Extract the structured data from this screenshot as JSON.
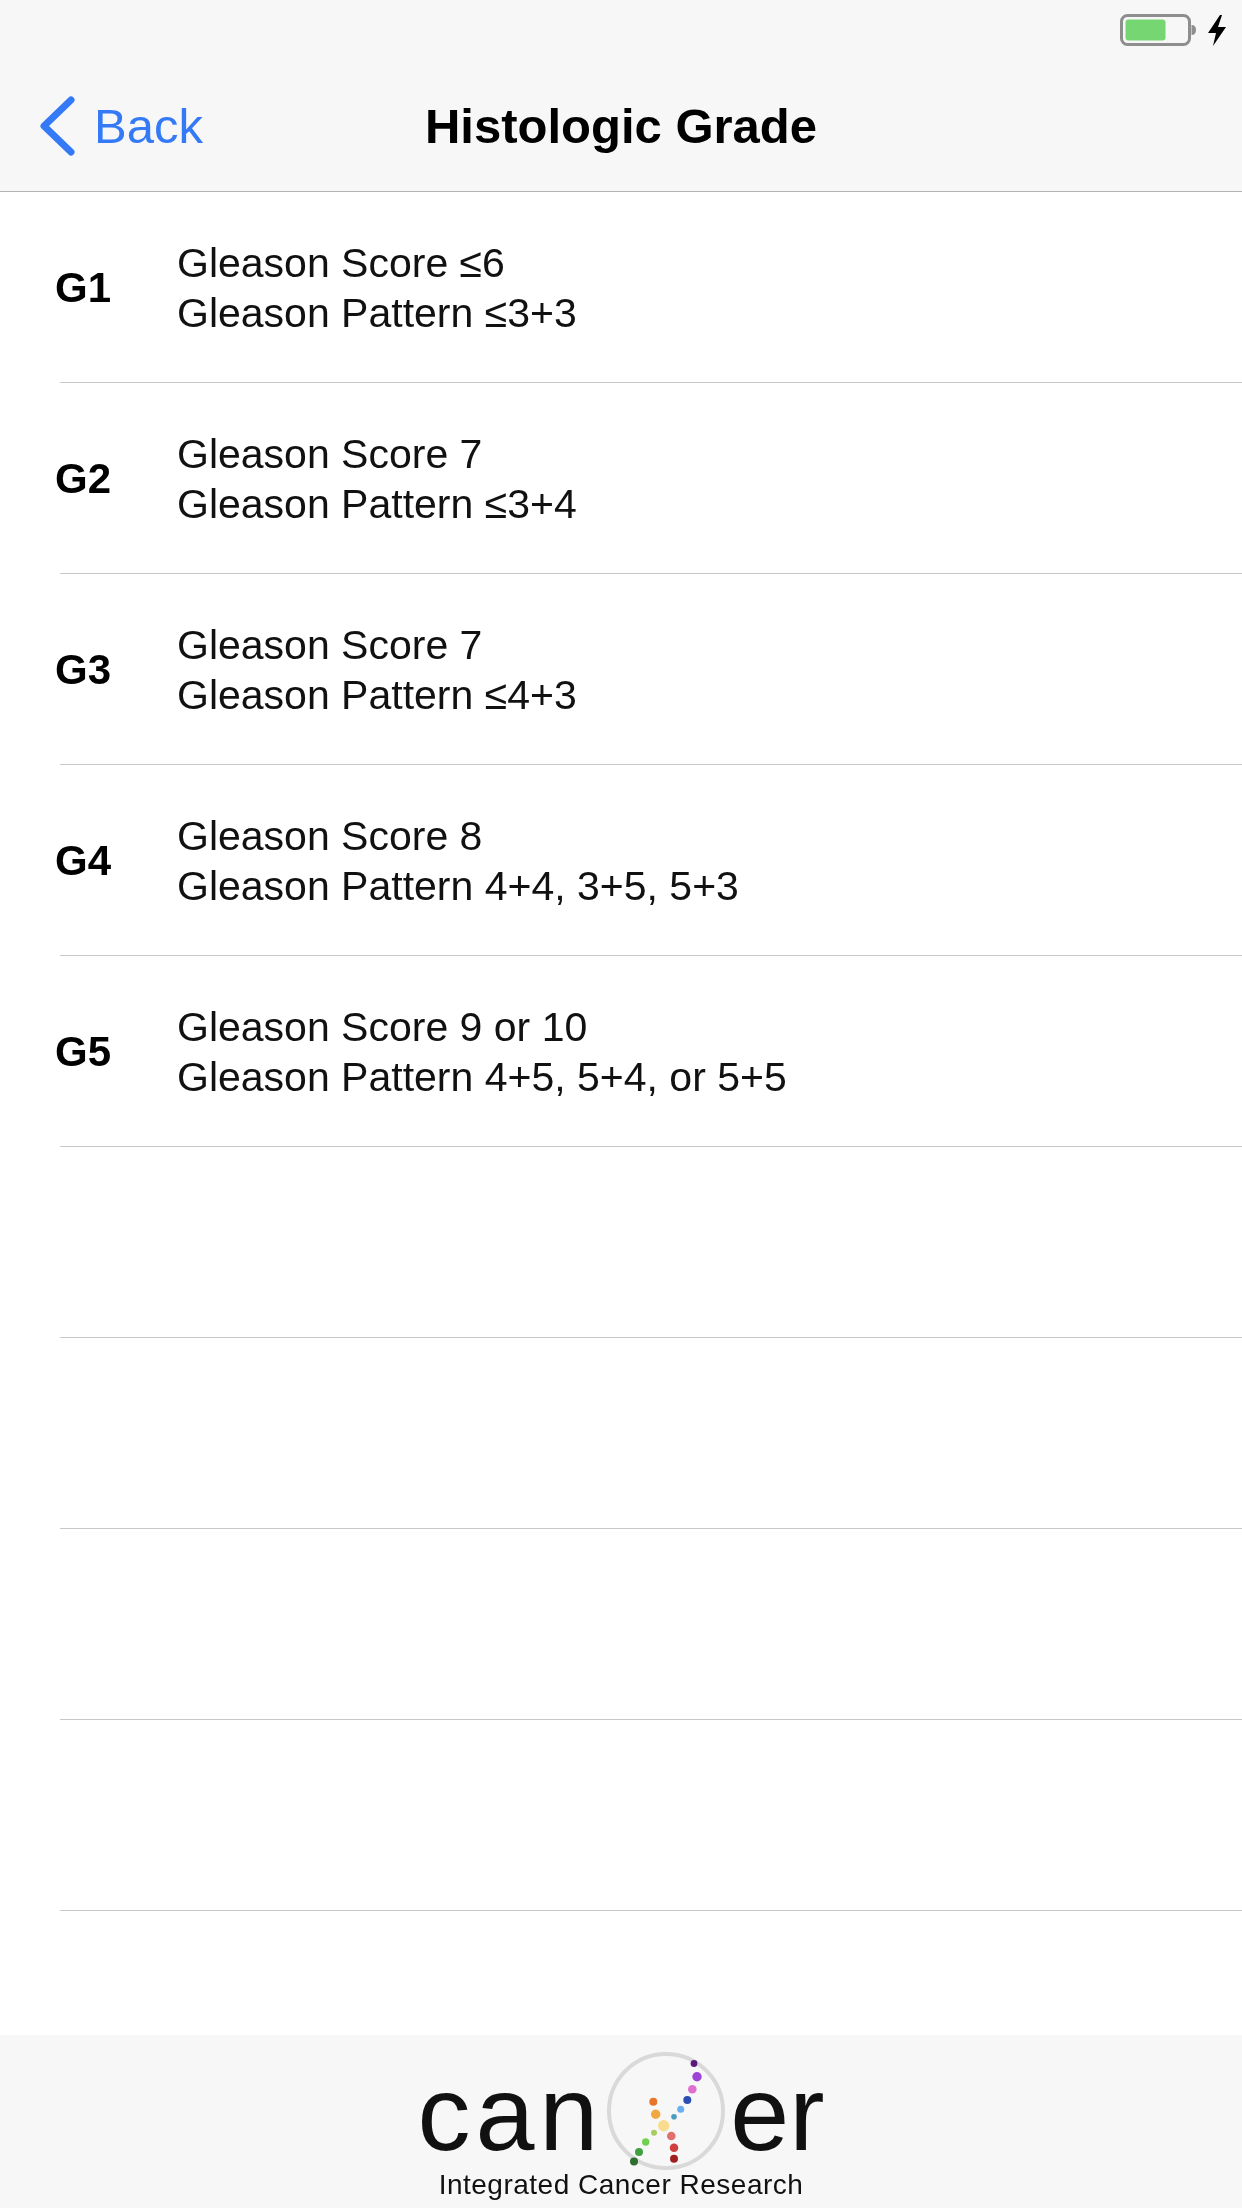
{
  "navigation_bar": {
    "back_label": "Back",
    "title": "Histologic Grade"
  },
  "grades": [
    {
      "grade": "G1",
      "score": "Gleason Score ≤6",
      "pattern": "Gleason Pattern ≤3+3"
    },
    {
      "grade": "G2",
      "score": "Gleason Score 7",
      "pattern": "Gleason Pattern ≤3+4"
    },
    {
      "grade": "G3",
      "score": "Gleason Score 7",
      "pattern": "Gleason Pattern ≤4+3"
    },
    {
      "grade": "G4",
      "score": "Gleason Score 8",
      "pattern": "Gleason Pattern 4+4, 3+5, 5+3"
    },
    {
      "grade": "G5",
      "score": "Gleason Score 9 or 10",
      "pattern": "Gleason Pattern 4+5, 5+4, or 5+5"
    }
  ],
  "footer": {
    "logo": {
      "text_start": "can",
      "text_end": "er",
      "tagline": "Integrated Cancer Research"
    }
  }
}
